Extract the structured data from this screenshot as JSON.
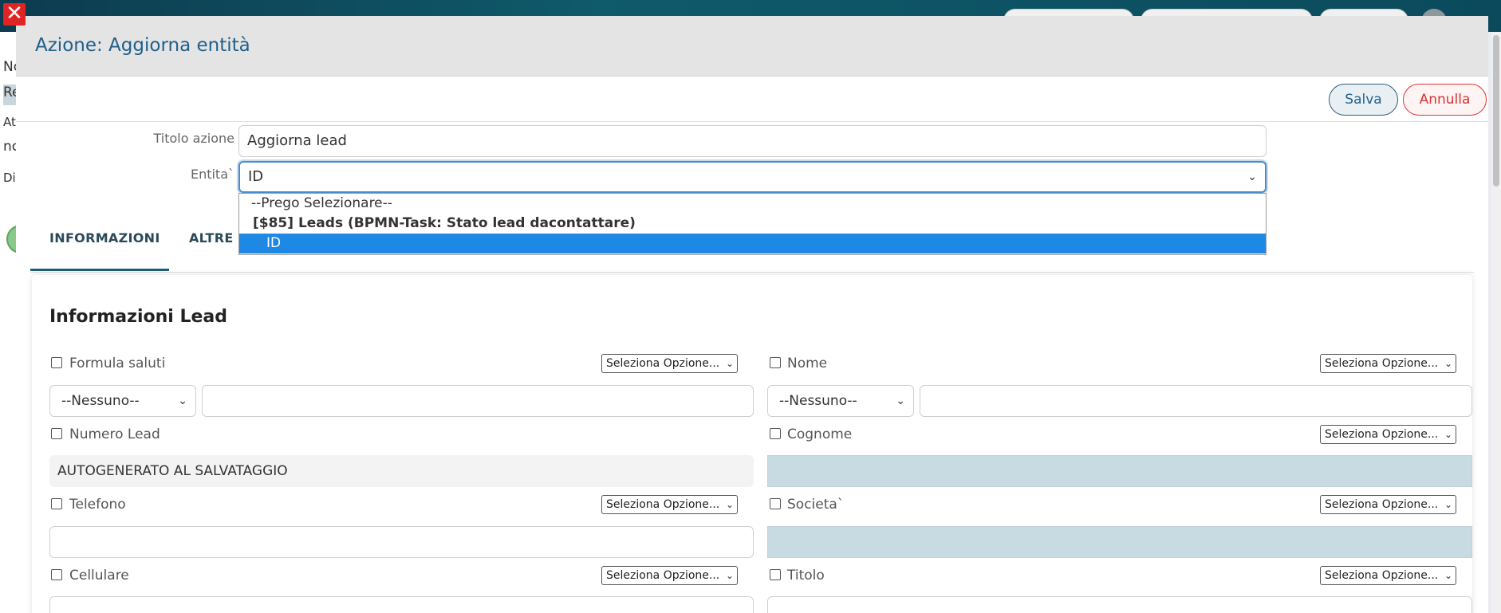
{
  "modal": {
    "title": "Azione: Aggiorna entità",
    "save_label": "Salva",
    "cancel_label": "Annulla"
  },
  "form": {
    "action_title_label": "Titolo azione",
    "action_title_value": "Aggiorna lead",
    "entity_label": "Entita`",
    "entity_value": "ID"
  },
  "dropdown": {
    "options": [
      "--Prego Selezionare--",
      "[$85] Leads (BPMN-Task: Stato lead dacontattare)",
      "ID"
    ],
    "selected": "ID"
  },
  "tabs": [
    {
      "label": "INFORMAZIONI",
      "active": true
    },
    {
      "label": "ALTRE I",
      "active": false
    }
  ],
  "panel": {
    "title": "Informazioni Lead",
    "option_placeholder": "Seleziona Opzione...",
    "none_option": "--Nessuno--",
    "fields": {
      "formula_saluti": "Formula saluti",
      "nome": "Nome",
      "numero_lead": "Numero Lead",
      "numero_lead_value": "AUTOGENERATO AL SALVATAGGIO",
      "cognome": "Cognome",
      "telefono": "Telefono",
      "societa": "Societa`",
      "cellulare": "Cellulare",
      "titolo": "Titolo"
    }
  },
  "background": {
    "side_letters": [
      "Nc",
      "Re",
      "At",
      "nc",
      "Di"
    ]
  },
  "colors": {
    "accent": "#1f5f8a",
    "cancel": "#e03131",
    "highlight": "#1e88e5"
  }
}
